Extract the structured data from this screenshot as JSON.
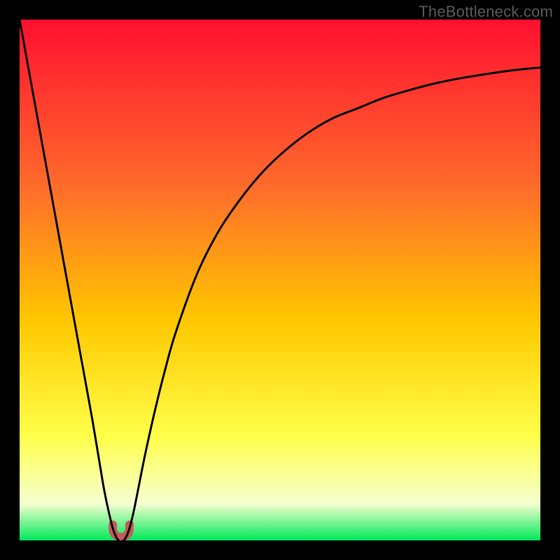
{
  "watermark": "TheBottleneck.com",
  "colors": {
    "gradient_top": "#ff1030",
    "gradient_upper": "#ff6b2b",
    "gradient_mid": "#ffc800",
    "gradient_lower": "#ffff4a",
    "gradient_pale": "#f5ffd0",
    "gradient_bottom": "#00e85a",
    "curve": "#000000",
    "marker_fill": "#c45a5a",
    "marker_stroke": "#a83d3d",
    "frame": "#000000"
  },
  "chart_data": {
    "type": "line",
    "title": "",
    "xlabel": "",
    "ylabel": "",
    "xlim": [
      0,
      100
    ],
    "ylim": [
      0,
      100
    ],
    "grid": false,
    "legend": "none",
    "annotations": [
      "TheBottleneck.com"
    ],
    "series": [
      {
        "name": "bottleneck-curve",
        "description": "Absolute deviation magnitude vs. component ratio; minimum at optimal balance point",
        "x": [
          0,
          2,
          4,
          6,
          8,
          10,
          12,
          14,
          16,
          17,
          18,
          19,
          20,
          21,
          22,
          24,
          26,
          28,
          30,
          34,
          38,
          42,
          46,
          50,
          55,
          60,
          65,
          70,
          75,
          80,
          85,
          90,
          95,
          100
        ],
        "y": [
          100,
          89,
          78,
          67,
          56,
          45,
          34,
          23,
          11,
          6,
          2,
          0,
          0,
          2,
          6,
          16,
          25,
          33,
          40,
          51,
          59,
          65,
          70,
          74,
          78,
          81,
          83,
          85,
          86.5,
          87.8,
          88.8,
          89.6,
          90.3,
          90.8
        ]
      }
    ],
    "marker": {
      "name": "optimal-point",
      "shape": "u",
      "x": 19.5,
      "y": 0,
      "width_x": 3.2,
      "height_y": 3.0
    }
  }
}
